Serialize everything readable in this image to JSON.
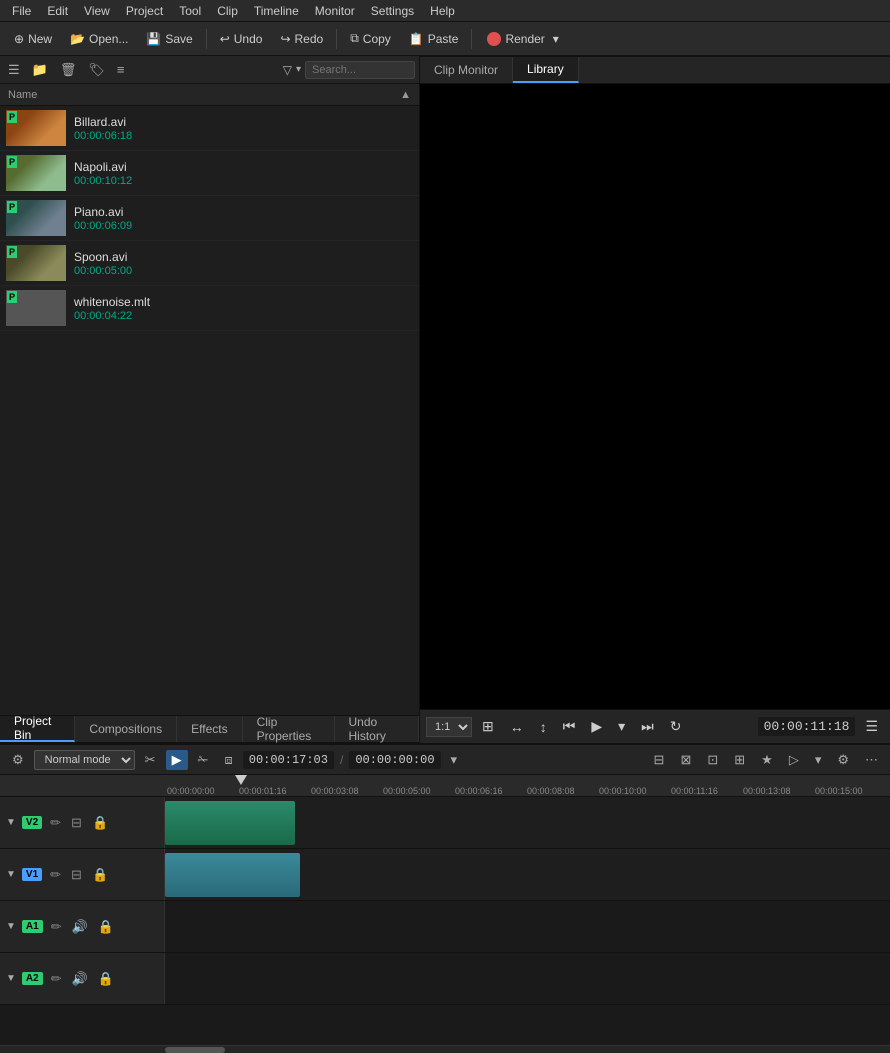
{
  "menubar": {
    "items": [
      "File",
      "Edit",
      "View",
      "Project",
      "Tool",
      "Clip",
      "Timeline",
      "Monitor",
      "Settings",
      "Help"
    ]
  },
  "toolbar": {
    "new_label": "New",
    "open_label": "Open...",
    "save_label": "Save",
    "undo_label": "Undo",
    "redo_label": "Redo",
    "copy_label": "Copy",
    "paste_label": "Paste",
    "render_label": "Render"
  },
  "bin_toolbar": {
    "search_placeholder": "Search..."
  },
  "file_list": {
    "header": "Name",
    "items": [
      {
        "name": "Billard.avi",
        "duration": "00:00:06:18",
        "thumb_class": "thumb-billard"
      },
      {
        "name": "Napoli.avi",
        "duration": "00:00:10:12",
        "thumb_class": "thumb-napoli"
      },
      {
        "name": "Piano.avi",
        "duration": "00:00:06:09",
        "thumb_class": "thumb-piano"
      },
      {
        "name": "Spoon.avi",
        "duration": "00:00:05:00",
        "thumb_class": "thumb-spoon"
      },
      {
        "name": "whitenoise.mlt",
        "duration": "00:00:04:22",
        "thumb_class": "thumb-whitenoise"
      }
    ]
  },
  "tabs": {
    "project": "Project Bin",
    "compositions": "Compositions",
    "effects": "Effects",
    "clip_properties": "Clip Properties",
    "undo_history": "Undo History",
    "clip_monitor": "Clip Monitor",
    "library": "Library"
  },
  "preview": {
    "zoom": "1:1",
    "timecode": "00:00:11:18"
  },
  "timeline": {
    "mode": "Normal mode",
    "timecode_current": "00:00:17:03",
    "timecode_end": "00:00:00:00",
    "ruler_marks": [
      "00:00:00:00",
      "00:00:01:16",
      "00:00:03:08",
      "00:00:05:00",
      "00:00:06:16",
      "00:00:08:08",
      "00:00:10:00",
      "00:00:11:16",
      "00:00:13:08",
      "00:00:15:00"
    ],
    "tracks": [
      {
        "label": "V2",
        "label_color": "green",
        "type": "video"
      },
      {
        "label": "V1",
        "label_color": "blue",
        "type": "video"
      },
      {
        "label": "A1",
        "label_color": "green",
        "type": "audio"
      },
      {
        "label": "A2",
        "label_color": "green",
        "type": "audio"
      }
    ]
  }
}
